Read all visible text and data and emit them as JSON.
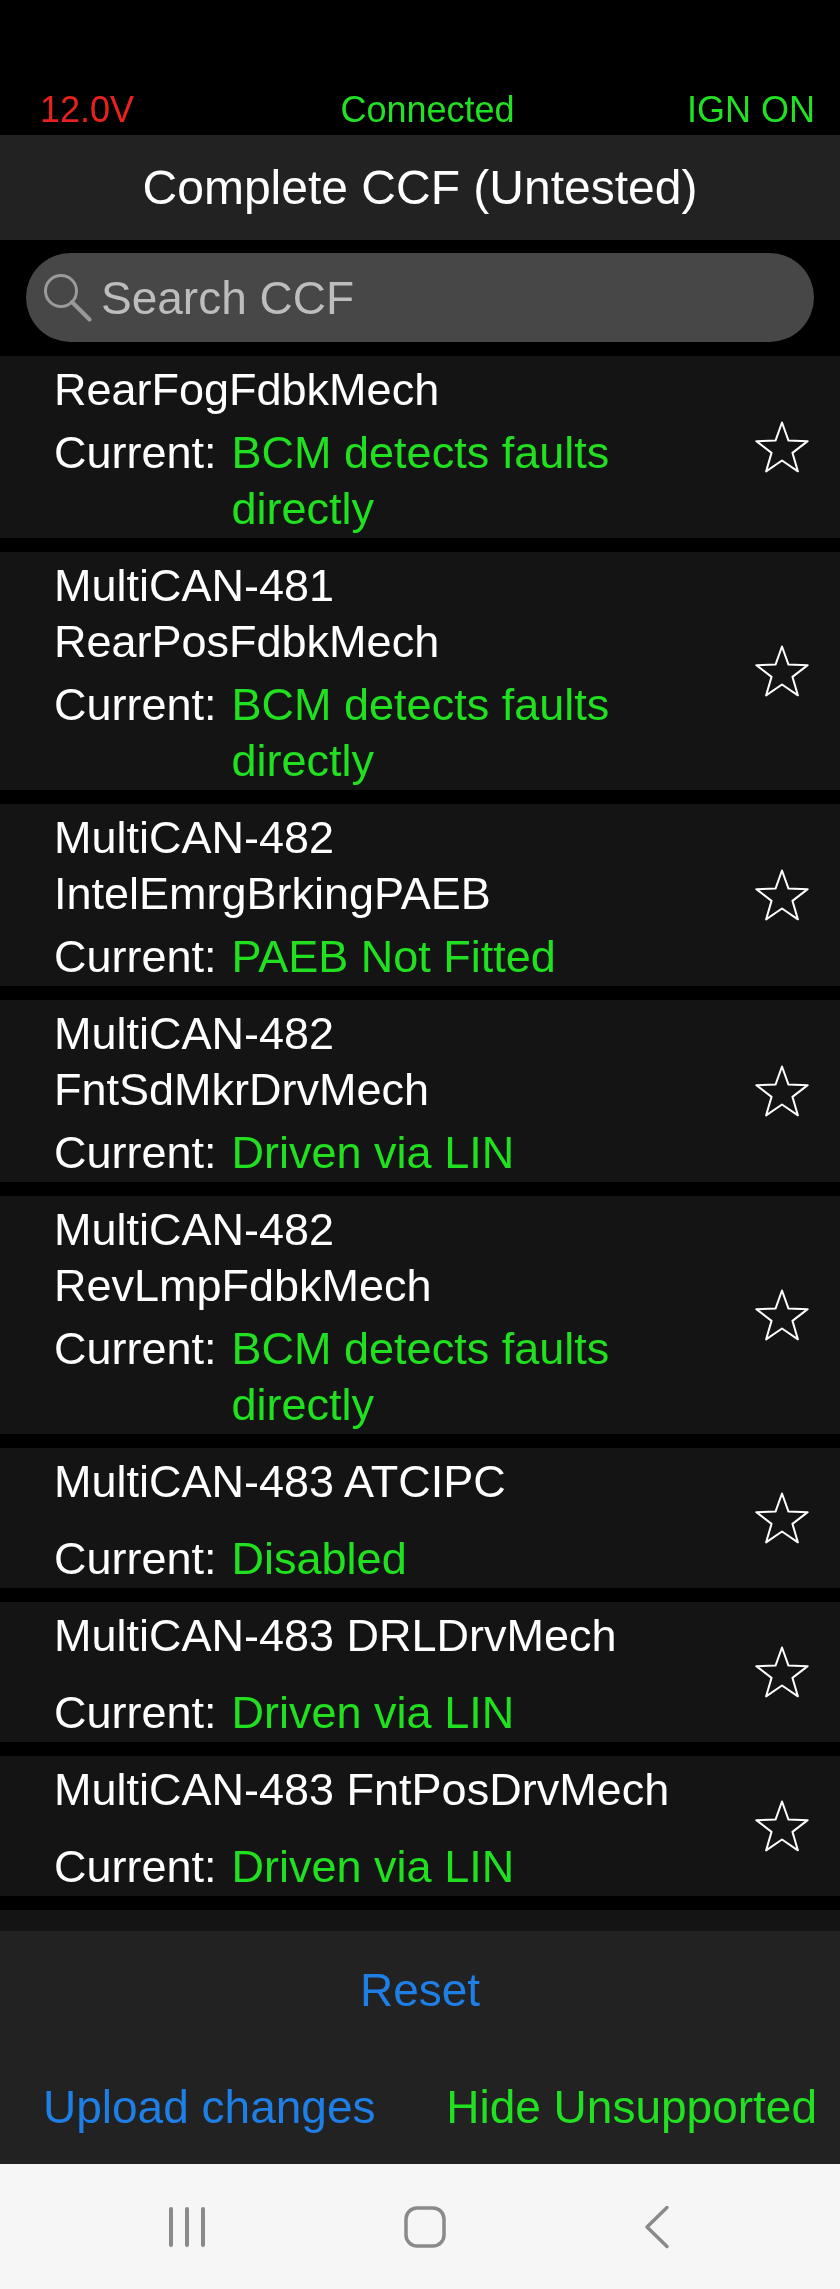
{
  "status_bar": [
    {
      "text": "12.0V",
      "color": "#e8211d"
    },
    {
      "text": "Connected",
      "color": "#22e022"
    },
    {
      "text": "IGN ON",
      "color": "#22e022"
    }
  ],
  "title": "Complete CCF (Untested)",
  "search": {
    "placeholder": "Search CCF"
  },
  "items": [
    {
      "name": "RearFogFdbkMech",
      "label": "Current:",
      "value": "BCM detects faults directly",
      "starred": false
    },
    {
      "name": "MultiCAN-481 RearPosFdbkMech",
      "label": "Current:",
      "value": "BCM detects faults directly",
      "starred": false
    },
    {
      "name": "MultiCAN-482 IntelEmrgBrkingPAEB",
      "label": "Current:",
      "value": "PAEB Not Fitted",
      "starred": false
    },
    {
      "name": "MultiCAN-482 FntSdMkrDrvMech",
      "label": "Current:",
      "value": "Driven via LIN",
      "starred": false
    },
    {
      "name": "MultiCAN-482 RevLmpFdbkMech",
      "label": "Current:",
      "value": "BCM detects faults directly",
      "starred": false
    },
    {
      "name": "MultiCAN-483 ATCIPC",
      "label": "Current:",
      "value": "Disabled",
      "starred": false
    },
    {
      "name": "MultiCAN-483 DRLDrvMech",
      "label": "Current:",
      "value": "Driven via LIN",
      "starred": false
    },
    {
      "name": "MultiCAN-483 FntPosDrvMech",
      "label": "Current:",
      "value": "Driven via LIN",
      "starred": false
    }
  ],
  "buttons": [
    {
      "label": "Reset",
      "color": "#1e7fe6"
    },
    {
      "label": "Upload changes",
      "color": "#1e7fe6"
    },
    {
      "label": "Hide Unsupported",
      "color": "#22e022"
    }
  ]
}
